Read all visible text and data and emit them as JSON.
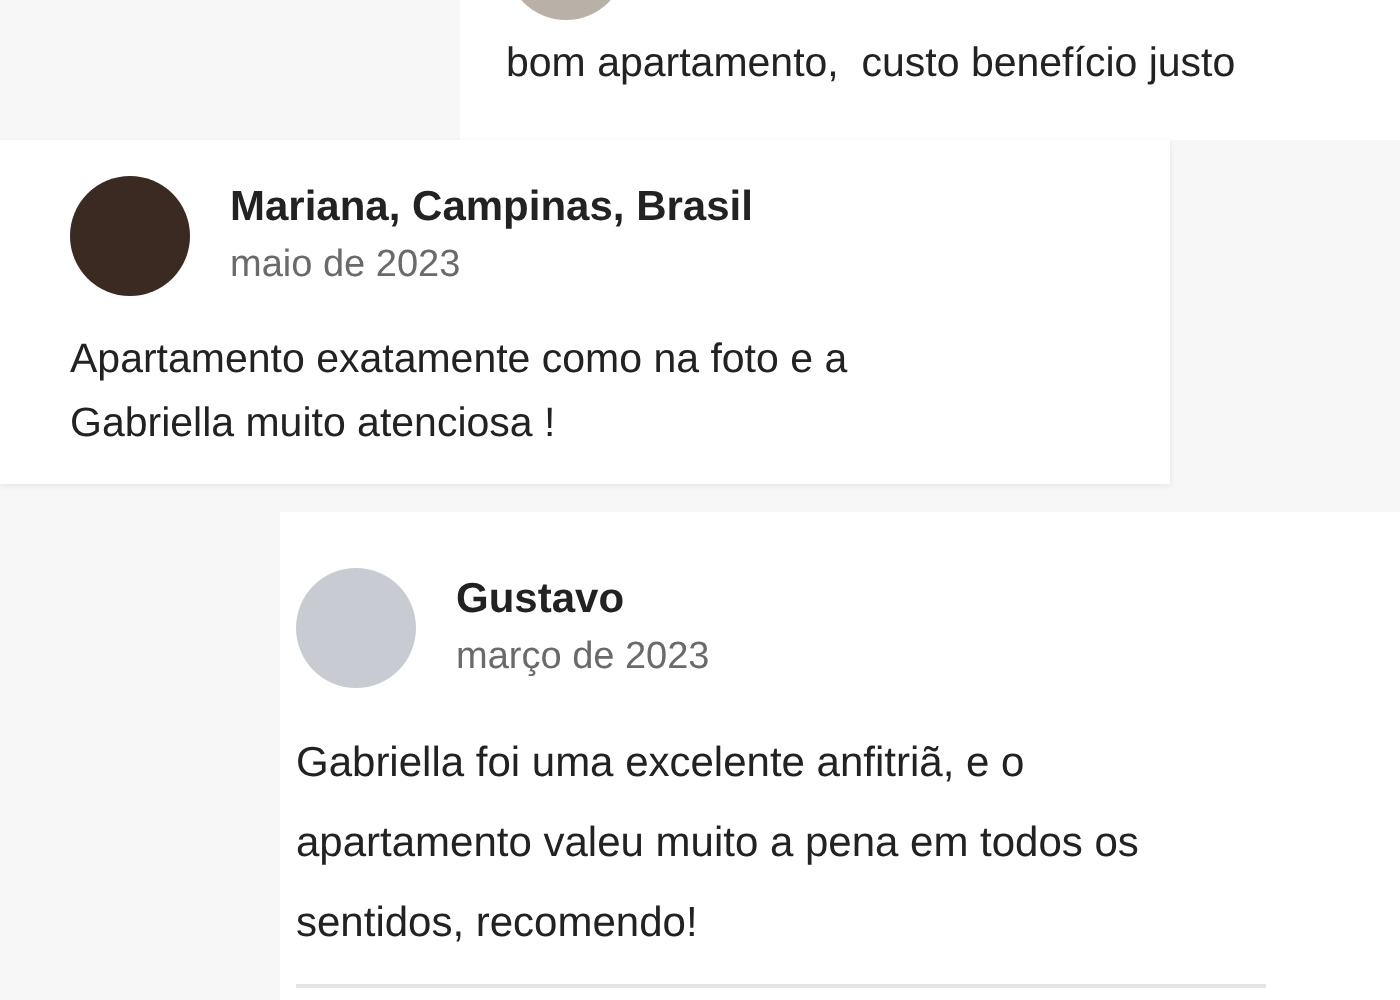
{
  "reviews": [
    {
      "text": "bom apartamento,  custo benefício justo"
    },
    {
      "name": "Mariana, Campinas, Brasil",
      "date": "maio de 2023",
      "text": "Apartamento exatamente como na foto e a Gabriella muito atenciosa !"
    },
    {
      "name": "Gustavo",
      "date": "março de 2023",
      "text": "Gabriella foi uma excelente anfitriã, e o apartamento valeu muito a pena em todos os sentidos, recomendo!"
    }
  ]
}
